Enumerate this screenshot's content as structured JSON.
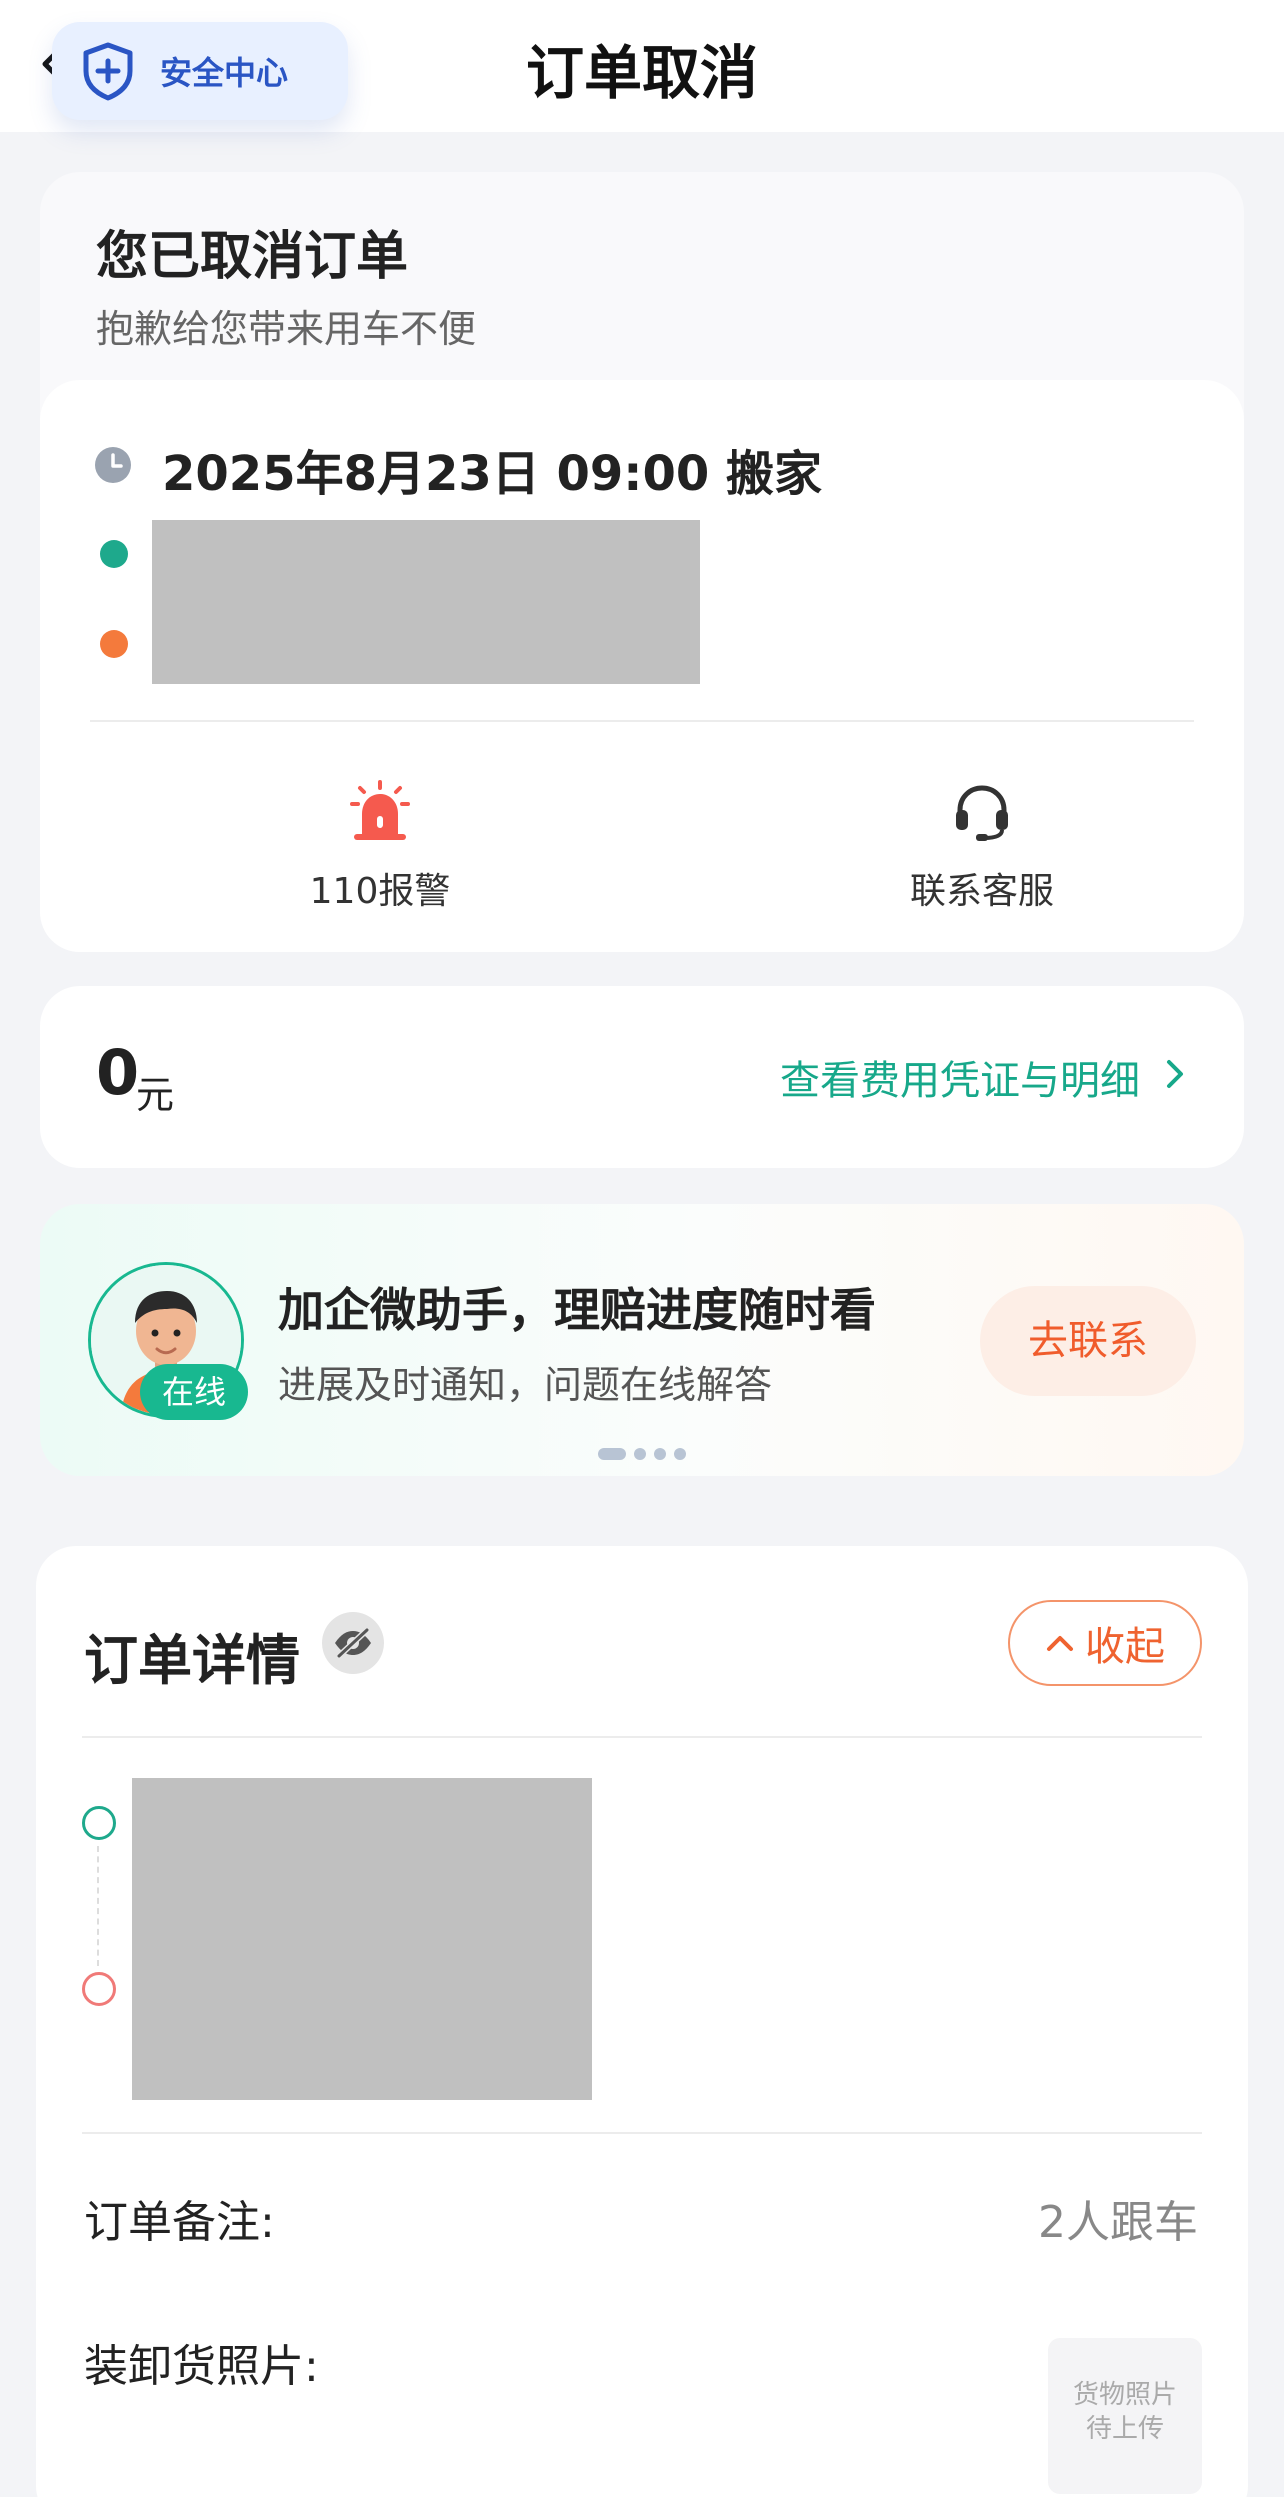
{
  "header": {
    "title": "订单取消",
    "safety_center_label": "安全中心"
  },
  "status": {
    "title": "您已取消订单",
    "subtitle": "抱歉给您带来用车不便",
    "order_time": "2025年8月23日 09:00 搬家",
    "actions": [
      {
        "label": "110报警",
        "icon": "alarm-icon"
      },
      {
        "label": "联系客服",
        "icon": "headset-icon"
      }
    ]
  },
  "fee": {
    "amount": "0",
    "unit": "元",
    "link_label": "查看费用凭证与明细"
  },
  "promo": {
    "title": "加企微助手，理赔进度随时看",
    "subtitle": "进展及时通知，问题在线解答",
    "online_badge": "在线",
    "button_label": "去联系",
    "pager_count": 4,
    "pager_active_index": 0
  },
  "details": {
    "title": "订单详情",
    "collapse_label": "收起",
    "remark_label": "订单备注:",
    "remark_value": "2人跟车",
    "photos_label": "装卸货照片:",
    "photo_placeholder_line1": "货物照片",
    "photo_placeholder_line2": "待上传"
  },
  "colors": {
    "accent_green": "#17a88a",
    "accent_orange": "#ef6330",
    "alarm_red": "#f55a4e",
    "safety_blue": "#2a55c4"
  }
}
